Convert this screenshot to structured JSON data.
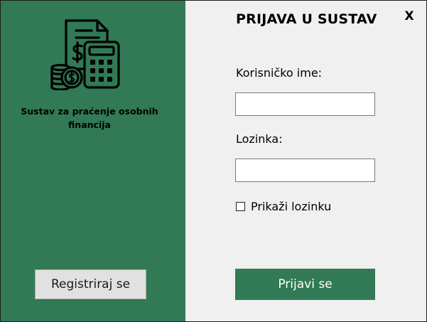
{
  "sidebar": {
    "tagline_line1": "Sustav za praćenje osobnih",
    "tagline_line2": "financija",
    "register_label": "Registriraj se",
    "logo_icon": "finance-calculator-icon"
  },
  "form": {
    "title": "PRIJAVA U SUSTAV",
    "close_label": "X",
    "username_label": "Korisničko ime:",
    "username_value": "",
    "password_label": "Lozinka:",
    "password_value": "",
    "show_password_label": "Prikaži lozinku",
    "show_password_checked": false,
    "login_label": "Prijavi se"
  },
  "colors": {
    "accent": "#317a55",
    "background": "#f0f0f0",
    "secondary_button": "#e1e1e1"
  }
}
